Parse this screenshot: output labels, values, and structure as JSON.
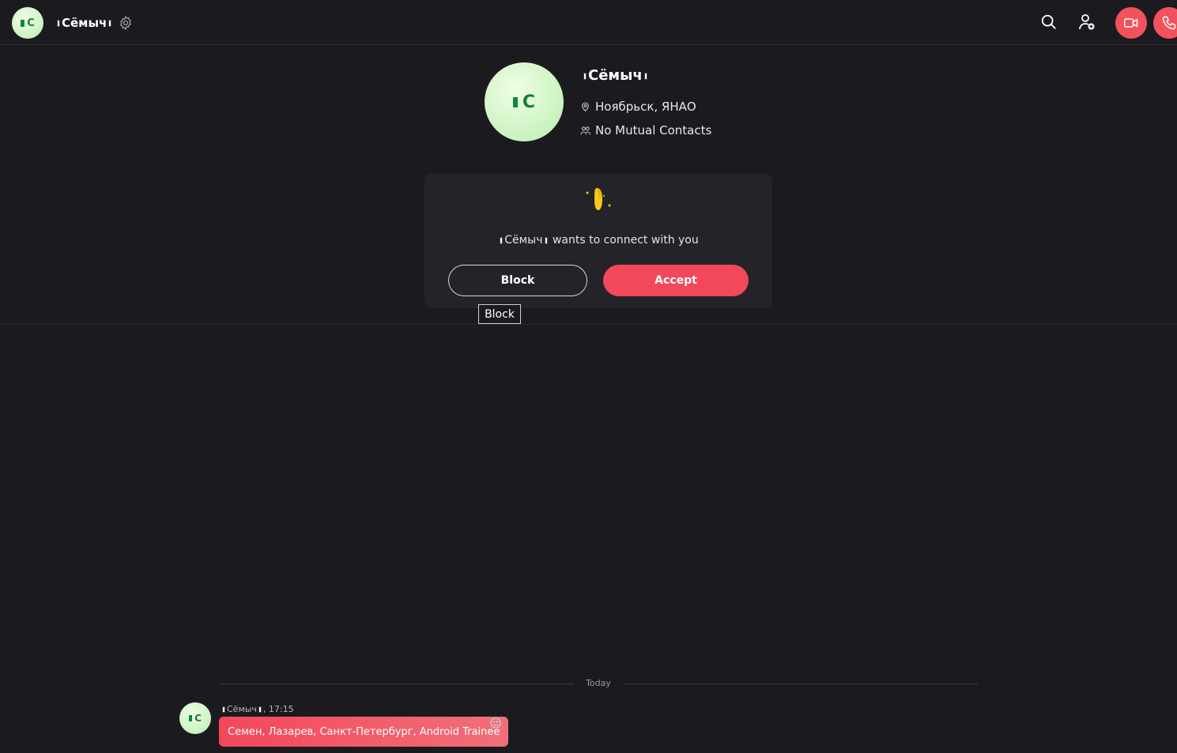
{
  "header": {
    "avatar_initial": "C",
    "name": "Сёмыч"
  },
  "profile": {
    "avatar_initial": "C",
    "name": "Сёмыч",
    "location": "Ноябрьск, ЯНАО",
    "mutual": "No Mutual Contacts"
  },
  "request": {
    "name": "Сёмыч",
    "text": "wants to connect with you",
    "block_label": "Block",
    "accept_label": "Accept",
    "tooltip": "Block"
  },
  "chat": {
    "date_divider": "Today",
    "messages": [
      {
        "avatar_initial": "C",
        "sender": "Сёмыч",
        "time": ", 17:15",
        "text": "Семен, Лазарев, Санкт-Петербург, Android Trainee"
      }
    ]
  },
  "colors": {
    "background": "#1b1b1f",
    "card": "#232328",
    "accent": "#f3475a",
    "avatar_green": "#c9f3c0"
  },
  "icons": [
    "settings-gear-icon",
    "search-icon",
    "add-contact-icon",
    "video-call-icon",
    "phone-call-icon",
    "location-pin-icon",
    "contacts-icon",
    "waving-hand-icon",
    "emoji-icon"
  ]
}
